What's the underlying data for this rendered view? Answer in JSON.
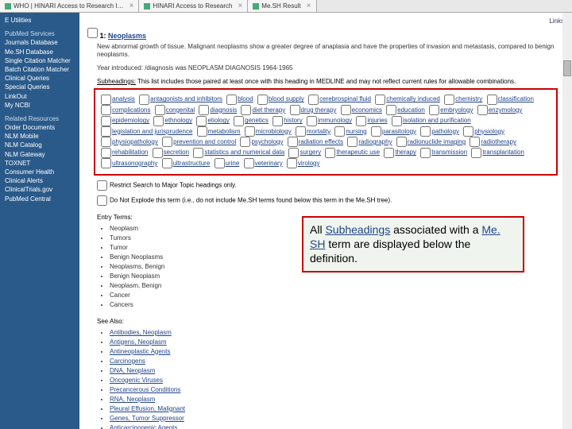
{
  "tabs": [
    {
      "label": "WHO | HINARI Access to Research I…"
    },
    {
      "label": "HINARI Access to Research"
    },
    {
      "label": "Me.SH Result"
    }
  ],
  "links_label": "Links",
  "sidebar": {
    "top_items": [
      "E Utilities"
    ],
    "section1_heading": "PubMed Services",
    "section1_items": [
      "Journals Database",
      "Me.SH Database",
      "Single Citation Matcher",
      "Batch Citation Matcher",
      "Clinical Queries",
      "Special Queries",
      "LinkOut",
      "My NCBI"
    ],
    "section2_heading": "Related Resources",
    "section2_items": [
      "Order Documents",
      "NLM Mobile",
      "NLM Catalog",
      "NLM Gateway",
      "TOXNET",
      "Consumer Health",
      "Clinical Alerts",
      "ClinicalTrials.gov",
      "PubMed Central"
    ]
  },
  "result": {
    "num": "1:",
    "title": "Neoplasms",
    "definition": "New abnormal growth of tissue. Malignant neoplasms show a greater degree of anaplasia and have the properties of invasion and metastasis, compared to benign neoplasms.",
    "year_intro": "Year introduced: /diagnosis was NEOPLASM DIAGNOSIS 1964-1965"
  },
  "subheadings_label": "Subheadings: This list includes those paired at least once with this heading in MEDLINE and may not reflect current rules for allowable combinations.",
  "subheadings": [
    "analysis",
    "antagonists and inhibitors",
    "blood",
    "blood supply",
    "cerebrospinal fluid",
    "chemically induced",
    "chemistry",
    "classification",
    "complications",
    "congenital",
    "diagnosis",
    "diet therapy",
    "drug therapy",
    "economics",
    "education",
    "embryology",
    "enzymology",
    "epidemiology",
    "ethnology",
    "etiology",
    "genetics",
    "history",
    "immunology",
    "injuries",
    "isolation and purification",
    "legislation and jurisprudence",
    "metabolism",
    "microbiology",
    "mortality",
    "nursing",
    "parasitology",
    "pathology",
    "physiology",
    "physiopathology",
    "prevention and control",
    "psychology",
    "radiation effects",
    "radiography",
    "radionuclide imaging",
    "radiotherapy",
    "rehabilitation",
    "secretion",
    "statistics and numerical data",
    "surgery",
    "therapeutic use",
    "therapy",
    "transmission",
    "transplantation",
    "ultrasonography",
    "ultrastructure",
    "urine",
    "veterinary",
    "virology"
  ],
  "restrict_major": "Restrict Search to Major Topic headings only.",
  "do_not_explode": "Do Not Explode this term (i.e., do not include Me.SH terms found below this term in the Me.SH tree).",
  "entry_terms_label": "Entry Terms:",
  "entry_terms": [
    "Neoplasm",
    "Tumors",
    "Tumor",
    "Benign Neoplasms",
    "Neoplasms, Benign",
    "Benign Neoplasm",
    "Neoplasm, Benign",
    "Cancer",
    "Cancers"
  ],
  "see_also_label": "See Also:",
  "see_also": [
    "Antibodies, Neoplasm",
    "Antigens, Neoplasm",
    "Antineoplastic Agents",
    "Carcinogens",
    "DNA, Neoplasm",
    "Oncogenic Viruses",
    "Precancerous Conditions",
    "RNA, Neoplasm",
    "Pleural Effusion, Malignant",
    "Genes, Tumor Suppressor",
    "Anticarcinogenic Agents"
  ],
  "callout": {
    "pre": "All ",
    "hl1": "Subheadings",
    "mid1": " associated with a ",
    "hl2": "Me. SH",
    "post": " term are displayed below the definition."
  }
}
